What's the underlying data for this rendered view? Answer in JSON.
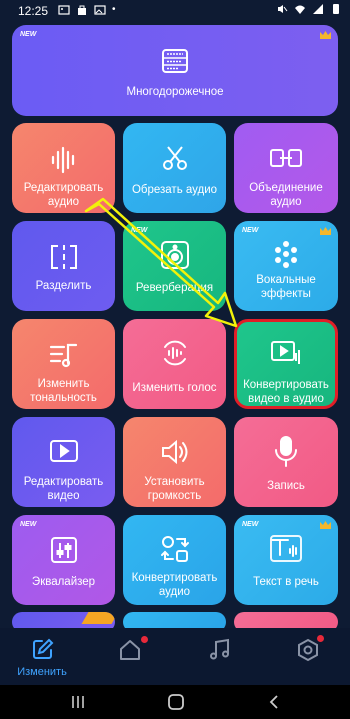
{
  "status_bar": {
    "time": "12:25"
  },
  "colors": {
    "highlight": "#e01e27",
    "arrow": "#f2f20a",
    "nav_active": "#3fa3ff",
    "badge": "#e8293a"
  },
  "new_badge": "NEW",
  "top_card": {
    "label": "Многодорожечное",
    "icon": "multitrack-icon"
  },
  "cards": [
    {
      "label": "Редактировать аудио",
      "icon": "waveform-icon"
    },
    {
      "label": "Обрезать аудио",
      "icon": "scissors-icon"
    },
    {
      "label": "Объединение аудио",
      "icon": "merge-icon"
    },
    {
      "label": "Разделить",
      "icon": "split-icon"
    },
    {
      "label": "Реверберация",
      "icon": "reverb-icon"
    },
    {
      "label": "Вокальные эффекты",
      "icon": "vocal-effects-icon"
    },
    {
      "label": "Изменить тональность",
      "icon": "pitch-icon"
    },
    {
      "label": "Изменить голос",
      "icon": "voice-change-icon"
    },
    {
      "label": "Конвертировать видео в аудио",
      "icon": "video-to-audio-icon"
    },
    {
      "label": "Редактировать видео",
      "icon": "play-video-icon"
    },
    {
      "label": "Установить громкость",
      "icon": "volume-icon"
    },
    {
      "label": "Запись",
      "icon": "microphone-icon"
    },
    {
      "label": "Эквалайзер",
      "icon": "equalizer-icon"
    },
    {
      "label": "Конвертировать аудио",
      "icon": "convert-audio-icon"
    },
    {
      "label": "Текст в речь",
      "icon": "text-to-speech-icon"
    }
  ],
  "bottom_nav": {
    "edit_label": "Изменить"
  }
}
